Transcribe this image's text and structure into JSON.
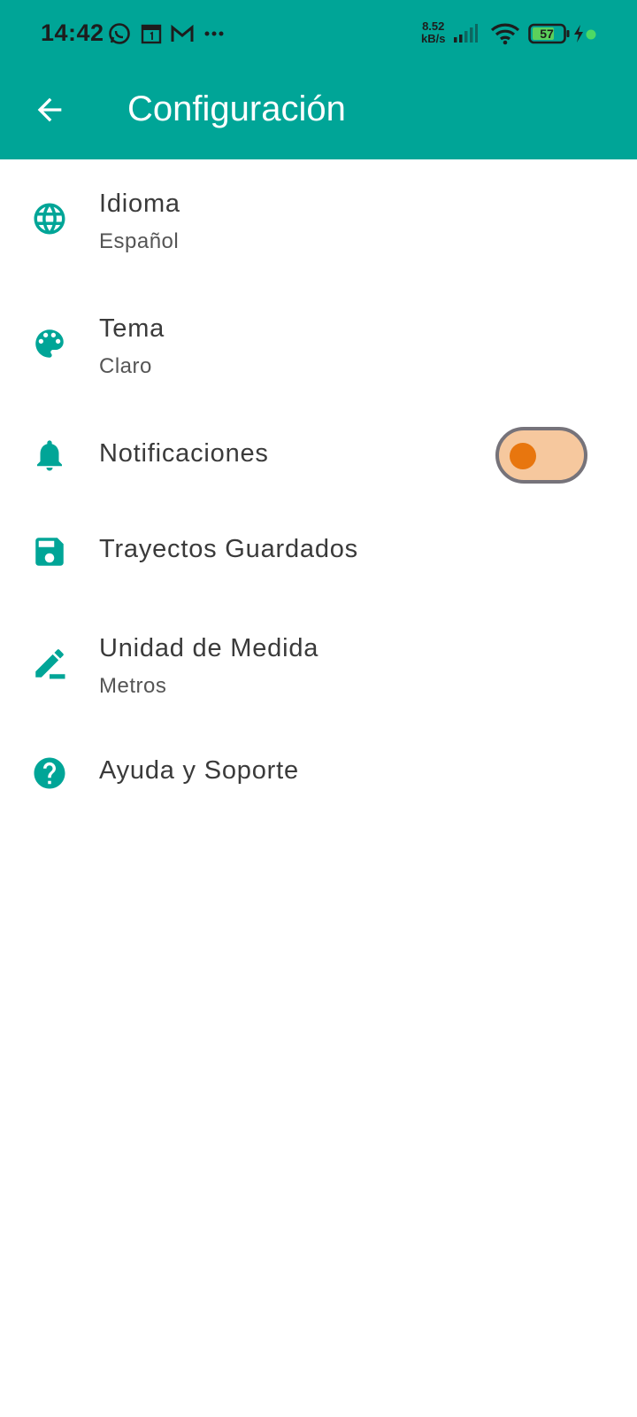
{
  "status_bar": {
    "time": "14:42",
    "net_speed_value": "8.52",
    "net_speed_unit": "kB/s",
    "battery_level": "57",
    "notification_icons": [
      "whatsapp-icon",
      "calendar-icon",
      "gmail-icon",
      "more-dots-icon"
    ]
  },
  "appbar": {
    "title": "Configuración",
    "back_icon": "arrow-back-icon",
    "color": "#00A597"
  },
  "settings": [
    {
      "icon": "globe-icon",
      "label": "Idioma",
      "sub": "Español"
    },
    {
      "icon": "palette-icon",
      "label": "Tema",
      "sub": "Claro"
    },
    {
      "icon": "bell-icon",
      "label": "Notificaciones",
      "toggle_on": false
    },
    {
      "icon": "save-icon",
      "label": "Trayectos Guardados"
    },
    {
      "icon": "edit-pencil-icon",
      "label": "Unidad de Medida",
      "sub": "Metros"
    },
    {
      "icon": "help-circle-icon",
      "label": "Ayuda y Soporte"
    }
  ],
  "colors": {
    "accent": "#00A597",
    "toggle_track": "#F6C89E",
    "toggle_knob": "#E8760E",
    "toggle_border": "#76737A"
  }
}
